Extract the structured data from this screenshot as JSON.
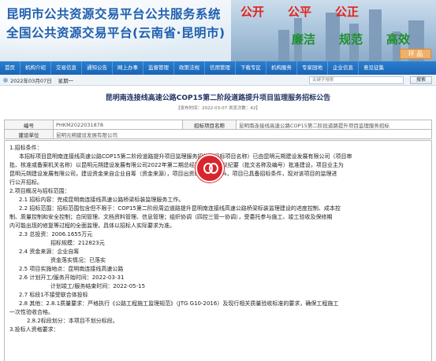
{
  "banner": {
    "title_line1": "昆明市公共资源交易平台公共服务系统",
    "title_line2": "全国公共资源交易平台(云南省·昆明市)",
    "slogan_top": [
      "公开",
      "公平",
      "公正"
    ],
    "slogan_bottom": [
      "廉洁",
      "规范",
      "高效"
    ],
    "env_tag": "环 品",
    "colors": {
      "title": "#1f5fae",
      "slogan_red": "#e0231c",
      "slogan_green": "#1e8f2c"
    }
  },
  "nav": {
    "items": [
      "首页",
      "机构介绍",
      "交易信息",
      "通知公告",
      "网上办事",
      "监督管理",
      "政策法规",
      "信用管理",
      "下载专区",
      "机构服务",
      "专家园地",
      "企业信息",
      "意见征集"
    ]
  },
  "infobar": {
    "date": "2022年03月07日",
    "week": "星期一",
    "search_placeholder": "关键字搜索",
    "search_button": "搜索"
  },
  "article": {
    "title": "昆明南连接线高速公路COP15第二阶段道路提升项目监理服务招标公告",
    "meta": "【发布时间：2022-03-07   浏览次数：42】"
  },
  "info_table": {
    "row1": {
      "label_code": "编号",
      "code": "PHKM2022031878",
      "label_project": "招标项目名称",
      "project": "昆明南连接线高速公路COP15第二阶段道路提升项目监理服务招标"
    },
    "row2": {
      "label_unit": "建设单位",
      "unit": "昆明元朔建设发展有限公司"
    }
  },
  "content": {
    "s1_head": "1.招标条件：",
    "s1_body1": "本招标项目昆明南连接线高速公路COP15第二阶段道路提升项目监理服务招标（招标项目名称）已由昆明元朔建设发展有限公司（项目审",
    "s1_body2": "批、核准或备案机关名称）以昆明元朔建设发展有限公司2022年第二期总经理办公会会议纪要（批文名称及编号）批准建设，项目业主为",
    "s1_body3": "昆明元朔建设发展有限公司，建设资金来自企业自筹（资金来源），项目出资比例为100%，项目已具备招标条件，现对该项目的监理进",
    "s1_body4": "行公开招标。",
    "s2_head": "2.项目概况与招标范围：",
    "s2_1": "2.1 招标内容：完成昆明南连接线高速公路桥梁标装监理服务工作。",
    "s2_2a": "2.2 招标范围：招标范围包含但不限于：COP15第二阶段周边道路提升昆明南连接线高速公路桥梁标装监理建设的进度控制、成本控",
    "s2_2b": "制、质量控制和安全控制；合同管理、文档资料管理、信息管理；组织协调（四控三管一协调），受委托参与施工、竣工验收及保修期",
    "s2_2c": "内可能出现的修复等过程的全面监理，具体以招标人实际要求为准。",
    "s2_3a": "2.3 总投资：2006.1655万元",
    "s2_3b": "招标规模：212823元",
    "s2_4a": "2.4 资金来源：企业自筹",
    "s2_4b": "资金落实情况：已落实",
    "s2_5": "2.5 项目实施地点：昆明南连接线高速公路",
    "s2_6a": "2.6 计划开工/服务开始时间：2022-03-31",
    "s2_6b": "计划竣工/服务结束时间：2022-05-15",
    "s2_7": "2.7 标段1不接受联合体投标",
    "s2_8a": "2.8 其他：2.8.1质量要求：严格执行《公路工程施工监理规范》（JTG G10-2016）及现行相关质量验收标准的要求，确保工程施工",
    "s2_8b": "一次性验收合格。",
    "s2_8c": "2.8.2标段划分：本项目不划分标段。",
    "s3_head": "3.投标人资格要求："
  }
}
